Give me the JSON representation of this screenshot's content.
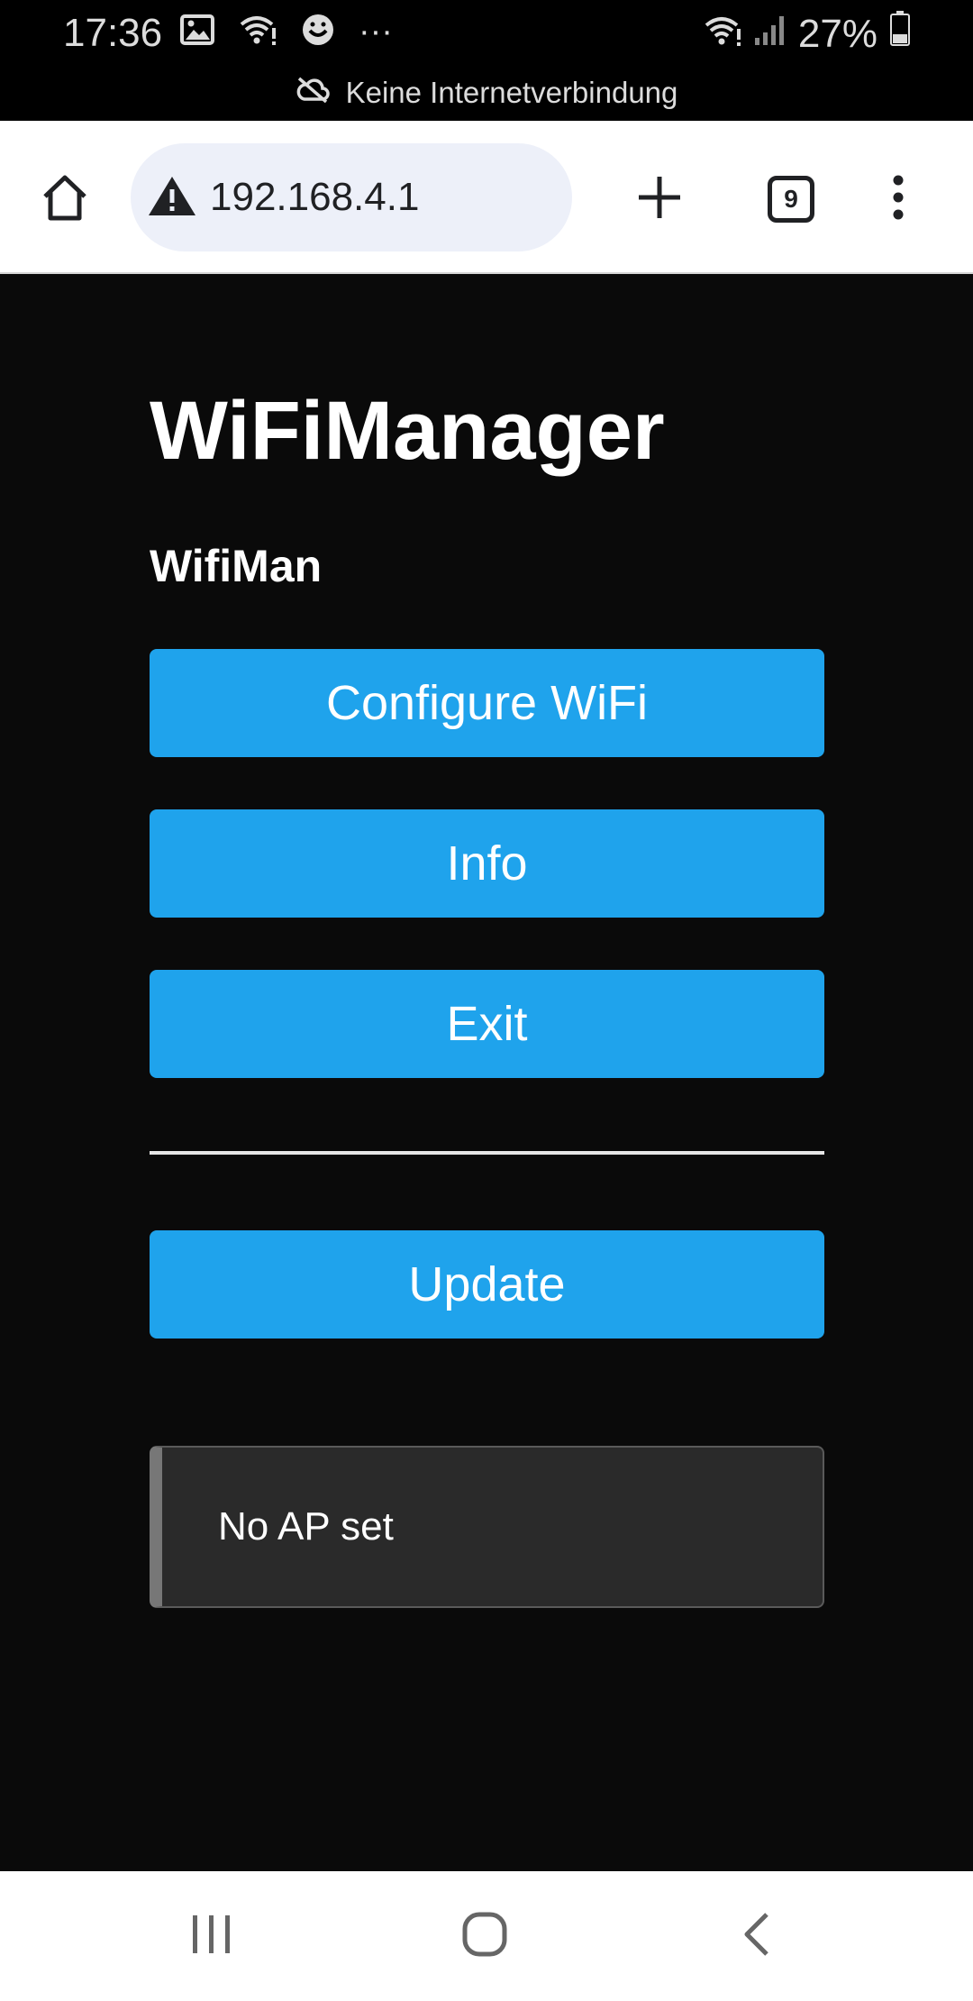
{
  "status_bar": {
    "time": "17:36",
    "battery": "27%",
    "notice": "Keine Internetverbindung",
    "more_label": "···"
  },
  "browser": {
    "url": "192.168.4.1",
    "tab_count": "9"
  },
  "page": {
    "title": "WiFiManager",
    "subtitle": "WifiMan",
    "buttons": {
      "configure": "Configure WiFi",
      "info": "Info",
      "exit": "Exit",
      "update": "Update"
    },
    "message": "No AP set"
  },
  "colors": {
    "accent": "#1fa3ec",
    "page_background": "#0a0a0a",
    "message_background": "#2a2a2a"
  }
}
